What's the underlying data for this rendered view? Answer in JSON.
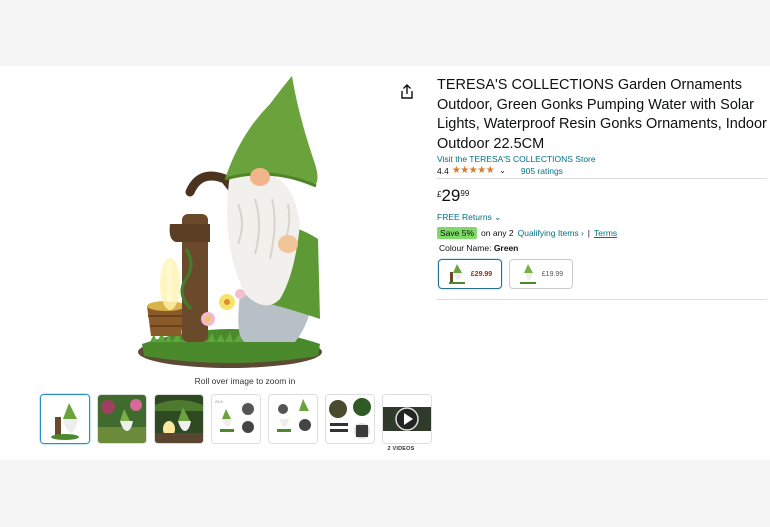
{
  "product": {
    "title": "TERESA'S COLLECTIONS Garden Ornaments Outdoor, Green Gonks Pumping Water with Solar Lights, Waterproof Resin Gonks Ornaments, Indoor Outdoor 22.5CM",
    "store_link": "Visit the TERESA'S COLLECTIONS Store",
    "rating_value": "4.4",
    "stars": "★★★★★",
    "ratings_count": "905 ratings",
    "price_symbol": "£",
    "price_whole": "29",
    "price_fraction": "99",
    "returns": "FREE Returns",
    "save_badge": "Save 5%",
    "save_text": "on any 2",
    "qualifying_items": "Qualifying Items ›",
    "separator": "|",
    "terms": "Terms",
    "colour_label": "Colour Name:",
    "colour_value": "Green",
    "variants": [
      {
        "price": "£29.99",
        "selected": true
      },
      {
        "price": "£19.99",
        "selected": false
      }
    ]
  },
  "gallery": {
    "zoom_hint": "Roll over image to zoom in",
    "videos_label": "2 VIDEOS",
    "thumbnail_count": 7
  },
  "colors": {
    "link": "#007185",
    "star": "#de7921",
    "save_badge": "#7fda69",
    "price_accent": "#b12704"
  }
}
